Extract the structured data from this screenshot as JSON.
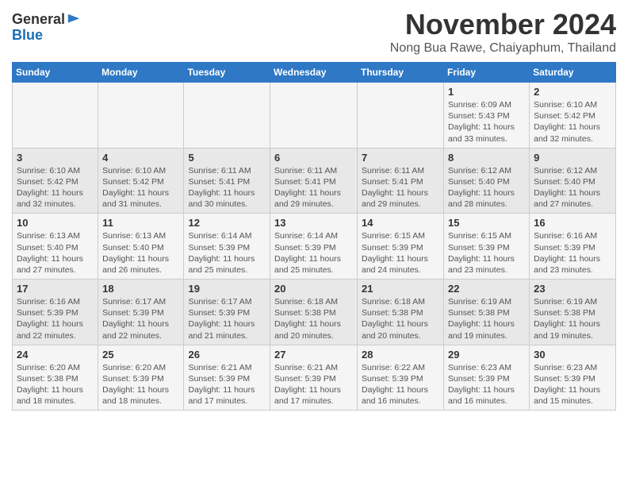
{
  "header": {
    "logo_general": "General",
    "logo_blue": "Blue",
    "title": "November 2024",
    "subtitle": "Nong Bua Rawe, Chaiyaphum, Thailand"
  },
  "weekdays": [
    "Sunday",
    "Monday",
    "Tuesday",
    "Wednesday",
    "Thursday",
    "Friday",
    "Saturday"
  ],
  "weeks": [
    [
      {
        "day": "",
        "info": ""
      },
      {
        "day": "",
        "info": ""
      },
      {
        "day": "",
        "info": ""
      },
      {
        "day": "",
        "info": ""
      },
      {
        "day": "",
        "info": ""
      },
      {
        "day": "1",
        "info": "Sunrise: 6:09 AM\nSunset: 5:43 PM\nDaylight: 11 hours\nand 33 minutes."
      },
      {
        "day": "2",
        "info": "Sunrise: 6:10 AM\nSunset: 5:42 PM\nDaylight: 11 hours\nand 32 minutes."
      }
    ],
    [
      {
        "day": "3",
        "info": "Sunrise: 6:10 AM\nSunset: 5:42 PM\nDaylight: 11 hours\nand 32 minutes."
      },
      {
        "day": "4",
        "info": "Sunrise: 6:10 AM\nSunset: 5:42 PM\nDaylight: 11 hours\nand 31 minutes."
      },
      {
        "day": "5",
        "info": "Sunrise: 6:11 AM\nSunset: 5:41 PM\nDaylight: 11 hours\nand 30 minutes."
      },
      {
        "day": "6",
        "info": "Sunrise: 6:11 AM\nSunset: 5:41 PM\nDaylight: 11 hours\nand 29 minutes."
      },
      {
        "day": "7",
        "info": "Sunrise: 6:11 AM\nSunset: 5:41 PM\nDaylight: 11 hours\nand 29 minutes."
      },
      {
        "day": "8",
        "info": "Sunrise: 6:12 AM\nSunset: 5:40 PM\nDaylight: 11 hours\nand 28 minutes."
      },
      {
        "day": "9",
        "info": "Sunrise: 6:12 AM\nSunset: 5:40 PM\nDaylight: 11 hours\nand 27 minutes."
      }
    ],
    [
      {
        "day": "10",
        "info": "Sunrise: 6:13 AM\nSunset: 5:40 PM\nDaylight: 11 hours\nand 27 minutes."
      },
      {
        "day": "11",
        "info": "Sunrise: 6:13 AM\nSunset: 5:40 PM\nDaylight: 11 hours\nand 26 minutes."
      },
      {
        "day": "12",
        "info": "Sunrise: 6:14 AM\nSunset: 5:39 PM\nDaylight: 11 hours\nand 25 minutes."
      },
      {
        "day": "13",
        "info": "Sunrise: 6:14 AM\nSunset: 5:39 PM\nDaylight: 11 hours\nand 25 minutes."
      },
      {
        "day": "14",
        "info": "Sunrise: 6:15 AM\nSunset: 5:39 PM\nDaylight: 11 hours\nand 24 minutes."
      },
      {
        "day": "15",
        "info": "Sunrise: 6:15 AM\nSunset: 5:39 PM\nDaylight: 11 hours\nand 23 minutes."
      },
      {
        "day": "16",
        "info": "Sunrise: 6:16 AM\nSunset: 5:39 PM\nDaylight: 11 hours\nand 23 minutes."
      }
    ],
    [
      {
        "day": "17",
        "info": "Sunrise: 6:16 AM\nSunset: 5:39 PM\nDaylight: 11 hours\nand 22 minutes."
      },
      {
        "day": "18",
        "info": "Sunrise: 6:17 AM\nSunset: 5:39 PM\nDaylight: 11 hours\nand 22 minutes."
      },
      {
        "day": "19",
        "info": "Sunrise: 6:17 AM\nSunset: 5:39 PM\nDaylight: 11 hours\nand 21 minutes."
      },
      {
        "day": "20",
        "info": "Sunrise: 6:18 AM\nSunset: 5:38 PM\nDaylight: 11 hours\nand 20 minutes."
      },
      {
        "day": "21",
        "info": "Sunrise: 6:18 AM\nSunset: 5:38 PM\nDaylight: 11 hours\nand 20 minutes."
      },
      {
        "day": "22",
        "info": "Sunrise: 6:19 AM\nSunset: 5:38 PM\nDaylight: 11 hours\nand 19 minutes."
      },
      {
        "day": "23",
        "info": "Sunrise: 6:19 AM\nSunset: 5:38 PM\nDaylight: 11 hours\nand 19 minutes."
      }
    ],
    [
      {
        "day": "24",
        "info": "Sunrise: 6:20 AM\nSunset: 5:38 PM\nDaylight: 11 hours\nand 18 minutes."
      },
      {
        "day": "25",
        "info": "Sunrise: 6:20 AM\nSunset: 5:39 PM\nDaylight: 11 hours\nand 18 minutes."
      },
      {
        "day": "26",
        "info": "Sunrise: 6:21 AM\nSunset: 5:39 PM\nDaylight: 11 hours\nand 17 minutes."
      },
      {
        "day": "27",
        "info": "Sunrise: 6:21 AM\nSunset: 5:39 PM\nDaylight: 11 hours\nand 17 minutes."
      },
      {
        "day": "28",
        "info": "Sunrise: 6:22 AM\nSunset: 5:39 PM\nDaylight: 11 hours\nand 16 minutes."
      },
      {
        "day": "29",
        "info": "Sunrise: 6:23 AM\nSunset: 5:39 PM\nDaylight: 11 hours\nand 16 minutes."
      },
      {
        "day": "30",
        "info": "Sunrise: 6:23 AM\nSunset: 5:39 PM\nDaylight: 11 hours\nand 15 minutes."
      }
    ]
  ]
}
